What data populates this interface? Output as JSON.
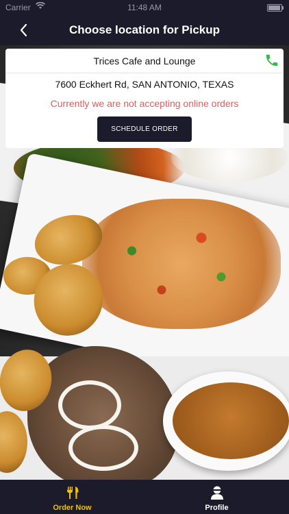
{
  "status_bar": {
    "carrier": "Carrier",
    "time": "11:48 AM",
    "wifi_icon": "wifi-icon",
    "battery_icon": "battery-icon"
  },
  "nav": {
    "title": "Choose location for Pickup",
    "back_icon": "chevron-left-icon"
  },
  "location": {
    "name": "Trices Cafe and Lounge",
    "address": "7600 Eckhert Rd, SAN ANTONIO, TEXAS",
    "status_message": "Currently we are not accepting online orders",
    "schedule_button_label": "SCHEDULE ORDER",
    "phone_icon": "phone-icon"
  },
  "tabs": [
    {
      "label": "Order Now",
      "icon": "dining-icon",
      "active": true
    },
    {
      "label": "Profile",
      "icon": "user-icon",
      "active": false
    }
  ],
  "colors": {
    "brand_dark": "#1b1b2b",
    "alert_red": "#e05b5b",
    "active_tab": "#f2c200",
    "phone_green": "#2fbd4a"
  }
}
